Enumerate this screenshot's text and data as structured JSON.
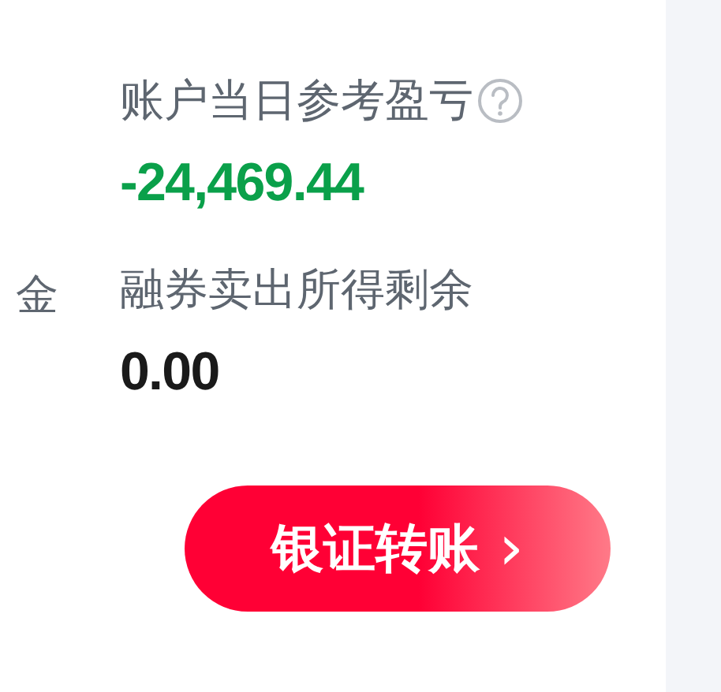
{
  "left_column": {
    "label": "金"
  },
  "fields": [
    {
      "label": "账户当日参考盈亏",
      "help": true,
      "value": "-24,469.44",
      "color": "#0aa04a"
    },
    {
      "label": "融券卖出所得剩余",
      "help": false,
      "value": "0.00",
      "color": "#1a1a1a"
    }
  ],
  "transfer_button": {
    "label": "银证转账",
    "arrow": "›"
  }
}
